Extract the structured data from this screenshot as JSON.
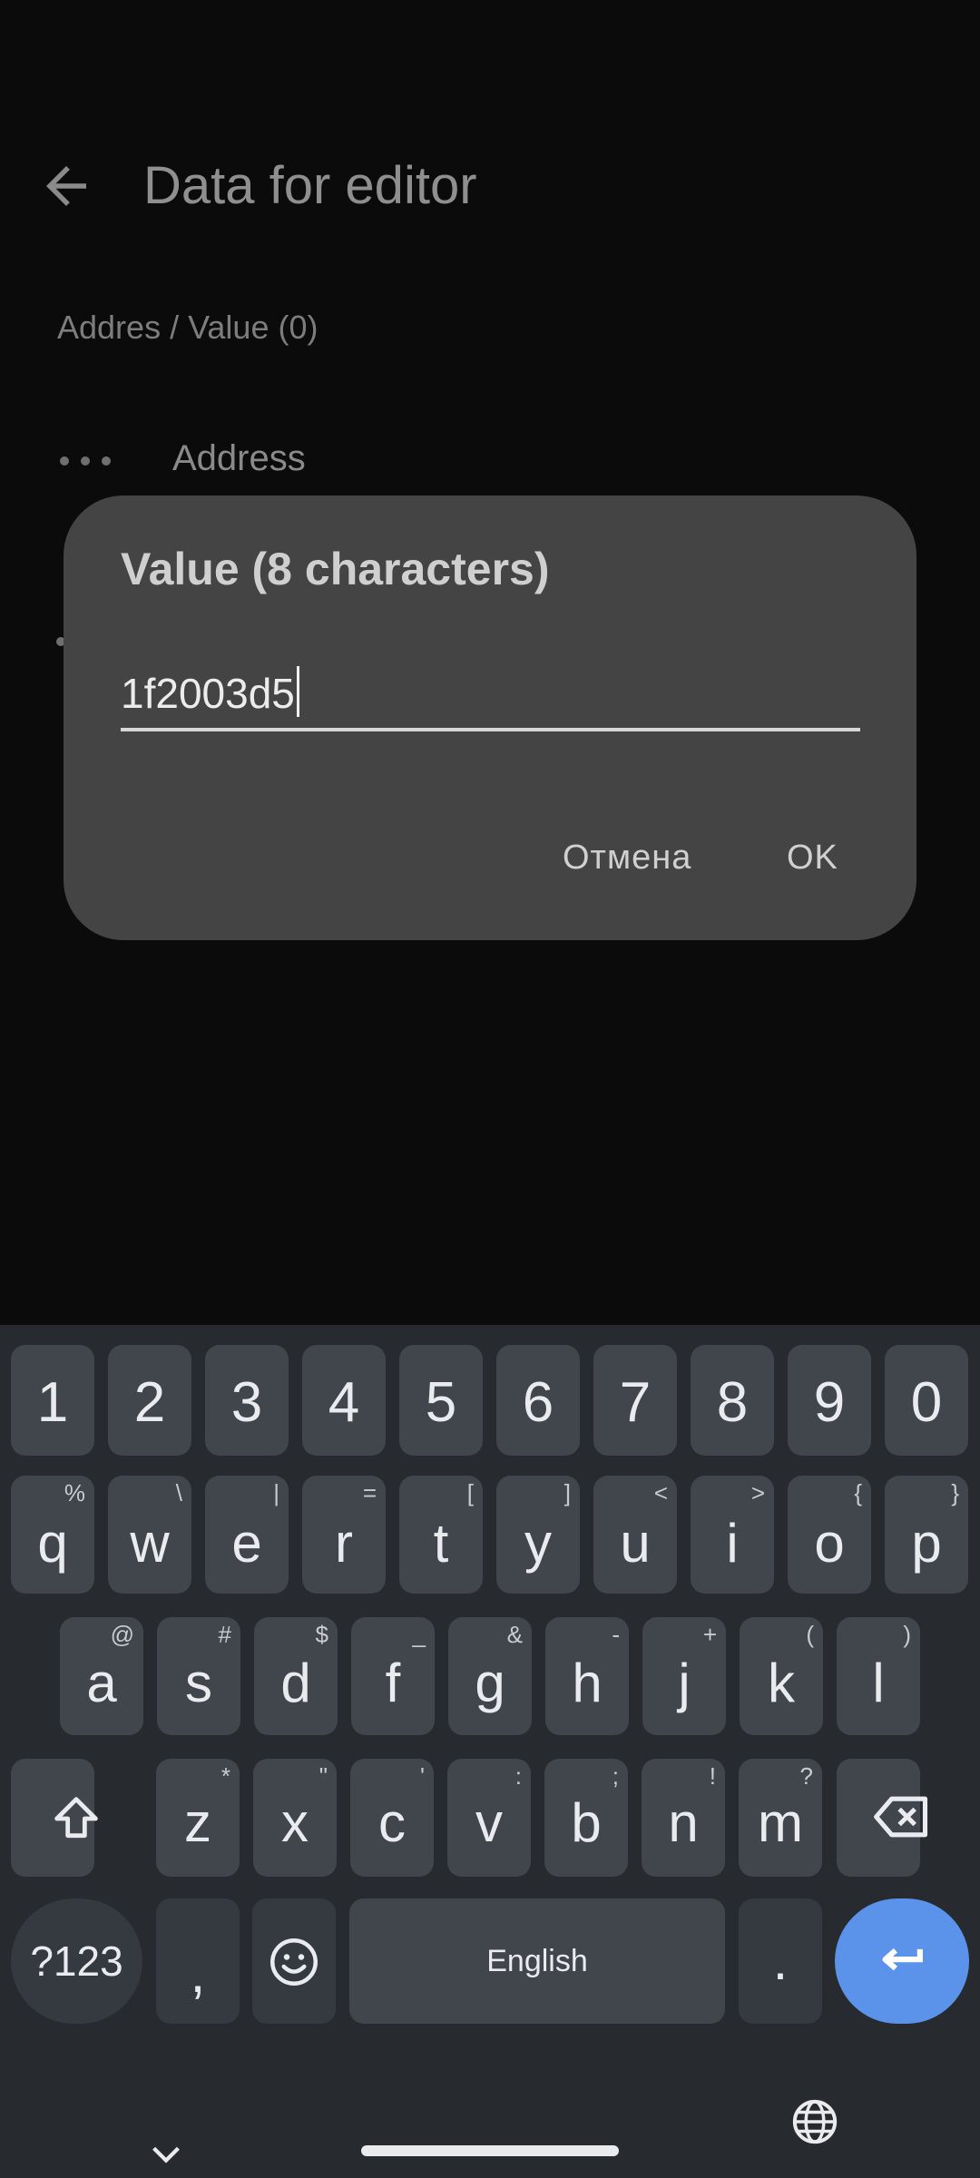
{
  "app": {
    "title": "Data for editor",
    "section_label": "Addres / Value (0)",
    "row_label": "Address",
    "icons": {
      "back": "arrow-back-icon",
      "drag": "more-dots-icon"
    }
  },
  "dialog": {
    "title": "Value (8 characters)",
    "input_value": "1f2003d5",
    "cancel_label": "Отмена",
    "ok_label": "OK"
  },
  "keyboard": {
    "numbers": [
      "1",
      "2",
      "3",
      "4",
      "5",
      "6",
      "7",
      "8",
      "9",
      "0"
    ],
    "row_q": [
      {
        "k": "q",
        "h": "%"
      },
      {
        "k": "w",
        "h": "\\"
      },
      {
        "k": "e",
        "h": "|"
      },
      {
        "k": "r",
        "h": "="
      },
      {
        "k": "t",
        "h": "["
      },
      {
        "k": "y",
        "h": "]"
      },
      {
        "k": "u",
        "h": "<"
      },
      {
        "k": "i",
        "h": ">"
      },
      {
        "k": "o",
        "h": "{"
      },
      {
        "k": "p",
        "h": "}"
      }
    ],
    "row_a": [
      {
        "k": "a",
        "h": "@"
      },
      {
        "k": "s",
        "h": "#"
      },
      {
        "k": "d",
        "h": "$"
      },
      {
        "k": "f",
        "h": "_"
      },
      {
        "k": "g",
        "h": "&"
      },
      {
        "k": "h",
        "h": "-"
      },
      {
        "k": "j",
        "h": "+"
      },
      {
        "k": "k",
        "h": "("
      },
      {
        "k": "l",
        "h": ")"
      }
    ],
    "row_z": [
      {
        "k": "z",
        "h": "*"
      },
      {
        "k": "x",
        "h": "\""
      },
      {
        "k": "c",
        "h": "'"
      },
      {
        "k": "v",
        "h": ":"
      },
      {
        "k": "b",
        "h": ";"
      },
      {
        "k": "n",
        "h": "!"
      },
      {
        "k": "m",
        "h": "?"
      }
    ],
    "sym_label": "?123",
    "comma": ",",
    "space_label": "English",
    "period": ".",
    "icons": {
      "shift": "shift-icon",
      "backspace": "backspace-icon",
      "emoji": "emoji-icon",
      "enter": "enter-icon",
      "hide": "chevron-down-icon",
      "language": "globe-icon"
    }
  }
}
